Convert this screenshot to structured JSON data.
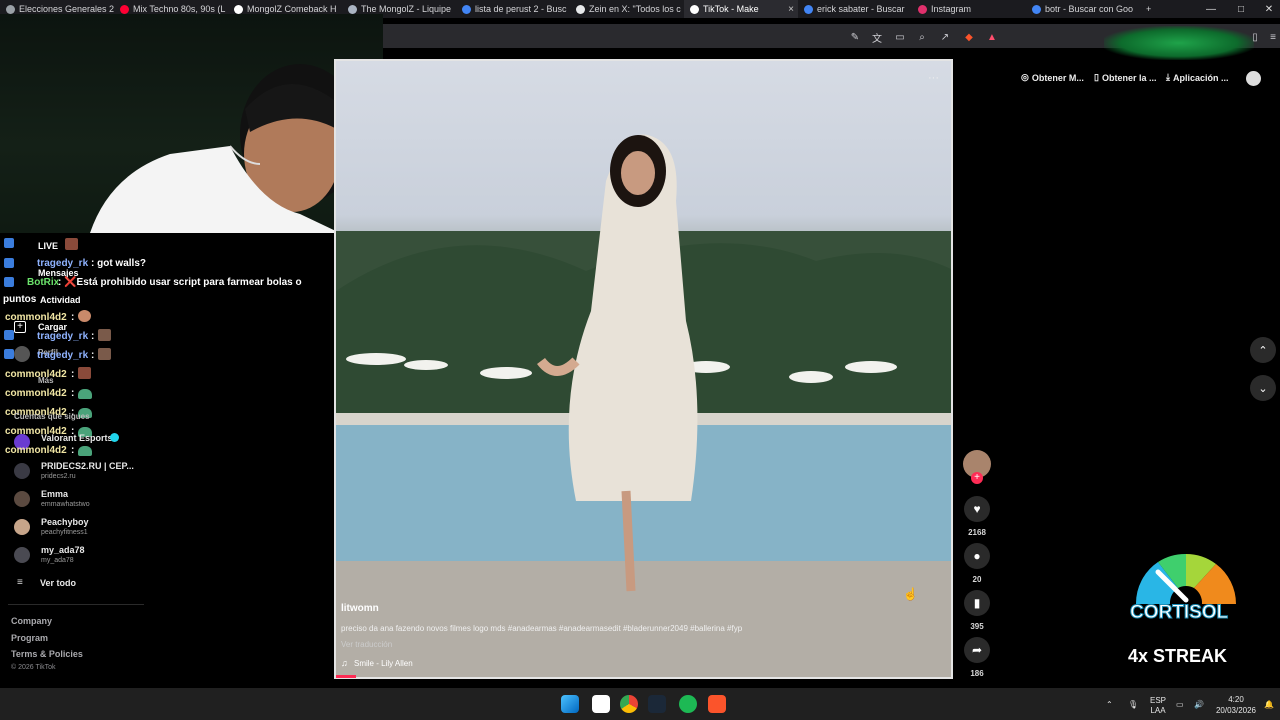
{
  "browser": {
    "tabs": [
      {
        "label": "Elecciones Generales 2",
        "color": "#9aa0a6"
      },
      {
        "label": "Mix Techno 80s, 90s (L",
        "color": "#ff0033"
      },
      {
        "label": "MongolZ Comeback H",
        "color": "#ffffff"
      },
      {
        "label": "The MongolZ - Liquipe",
        "color": "#aab4c2"
      },
      {
        "label": "lista de perust 2 - Busc",
        "color": "#4285f4"
      },
      {
        "label": "Zein en X: \"Todos los c",
        "color": "#e7e9ea"
      },
      {
        "label": "TikTok - Make",
        "color": "#ffffff",
        "active": true
      },
      {
        "label": "erick sabater - Buscar",
        "color": "#4285f4"
      },
      {
        "label": "Instagram",
        "color": "#e1306c"
      },
      {
        "label": "botr - Buscar con Goo",
        "color": "#4285f4"
      }
    ],
    "new_tab": "+",
    "window_controls": [
      "—",
      "□",
      "✕"
    ]
  },
  "top_actions": {
    "get_coins": "Obtener M...",
    "get_app": "Obtener la ...",
    "application": "Aplicación ..."
  },
  "chat": {
    "live_label": "LIVE",
    "messages_label": "Mensajes",
    "activity_label": "Actividad",
    "upload_label": "Cargar",
    "profile_label": "Perfil",
    "more_label": "Más",
    "following_label": "Cuentas que sigues",
    "lines": [
      {
        "user": "tragedy_rk",
        "text": ": got walls?"
      },
      {
        "user": "BotRix",
        "text": ": ❌Está prohibido usar script para farmear bolas o"
      },
      {
        "user": "",
        "text": "puntos"
      },
      {
        "user": "commonl4d2",
        "text": ":"
      },
      {
        "user": "tragedy_rk",
        "text": ":"
      },
      {
        "user": "tragedy_rk",
        "text": ":"
      },
      {
        "user": "commonl4d2",
        "text": ":"
      },
      {
        "user": "commonl4d2",
        "text": ":"
      },
      {
        "user": "commonl4d2",
        "text": ":"
      },
      {
        "user": "commonl4d2",
        "text": ":"
      },
      {
        "user": "commonl4d2",
        "text": ":"
      }
    ]
  },
  "following": [
    {
      "name": "Valorant Esports",
      "handle": ""
    },
    {
      "name": "PRIDECS2.RU | CEP...",
      "handle": "pridecs2.ru"
    },
    {
      "name": "Emma",
      "handle": "emmawhatstwo"
    },
    {
      "name": "Peachyboy",
      "handle": "peachyfitness1"
    },
    {
      "name": "my_ada78",
      "handle": "my_ada78"
    }
  ],
  "see_all": "Ver todo",
  "footer": {
    "company": "Company",
    "program": "Program",
    "terms": "Terms & Policies",
    "copyright": "© 2026 TikTok"
  },
  "video": {
    "author": "litwomn",
    "caption": "preciso da ana fazendo novos filmes logo mds #anadearmas #anadearmasedit #bladerunner2049 #ballerina #fyp",
    "translate": "Ver traducción",
    "music": "Smile - Lily Allen",
    "more": "···"
  },
  "actions": {
    "likes": "2168",
    "comments": "20",
    "saves": "395",
    "shares": "186"
  },
  "overlay": {
    "brand": "CORTISOL",
    "streak": "4x STREAK"
  },
  "taskbar": {
    "lang_top": "ESP",
    "lang_bottom": "LAA",
    "time": "4:20",
    "date": "20/03/2026"
  }
}
